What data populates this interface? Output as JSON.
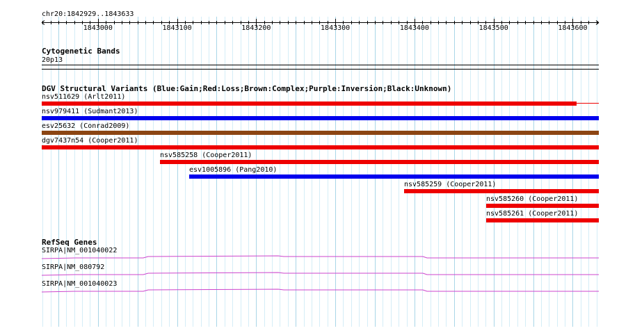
{
  "ruler": {
    "region": "chr20:1842929..1843633",
    "start": 1842929,
    "end": 1843633,
    "tick_labels": [
      "1843000",
      "1843100",
      "1843200",
      "1843300",
      "1843400",
      "1843500",
      "1843600"
    ]
  },
  "cytoband": {
    "title": "Cytogenetic Bands",
    "band": "20p13"
  },
  "dgv": {
    "title": "DGV Structural Variants (Blue:Gain;Red:Loss;Brown:Complex;Purple:Inversion;Black:Unknown)",
    "colors": {
      "gain": "#0000ee",
      "loss": "#ee0000",
      "complex": "#8b4513"
    },
    "variants": [
      {
        "label": "nsv511629 (Arlt2011)",
        "type": "loss",
        "start": 1842929,
        "end": 1843605,
        "extends_right": true
      },
      {
        "label": "nsv979411 (Sudmant2013)",
        "type": "gain",
        "start": 1842929,
        "end": 1843633
      },
      {
        "label": "esv25632 (Conrad2009)",
        "type": "complex",
        "start": 1842929,
        "end": 1843633
      },
      {
        "label": "dgv7437n54 (Cooper2011)",
        "type": "loss",
        "start": 1842929,
        "end": 1843633
      },
      {
        "label": "nsv585258 (Cooper2011)",
        "type": "loss",
        "start": 1843078,
        "end": 1843633
      },
      {
        "label": "esv1005896 (Pang2010)",
        "type": "gain",
        "start": 1843115,
        "end": 1843633
      },
      {
        "label": "nsv585259 (Cooper2011)",
        "type": "loss",
        "start": 1843387,
        "end": 1843633
      },
      {
        "label": "nsv585260 (Cooper2011)",
        "type": "loss",
        "start": 1843491,
        "end": 1843633
      },
      {
        "label": "nsv585261 (Cooper2011)",
        "type": "loss",
        "start": 1843491,
        "end": 1843633
      }
    ]
  },
  "refseq": {
    "title": "RefSeq Genes",
    "color": "#cc44cc",
    "genes": [
      {
        "label": "SIRPA|NM_001040022"
      },
      {
        "label": "SIRPA|NM_080792"
      },
      {
        "label": "SIRPA|NM_001040023"
      }
    ]
  }
}
